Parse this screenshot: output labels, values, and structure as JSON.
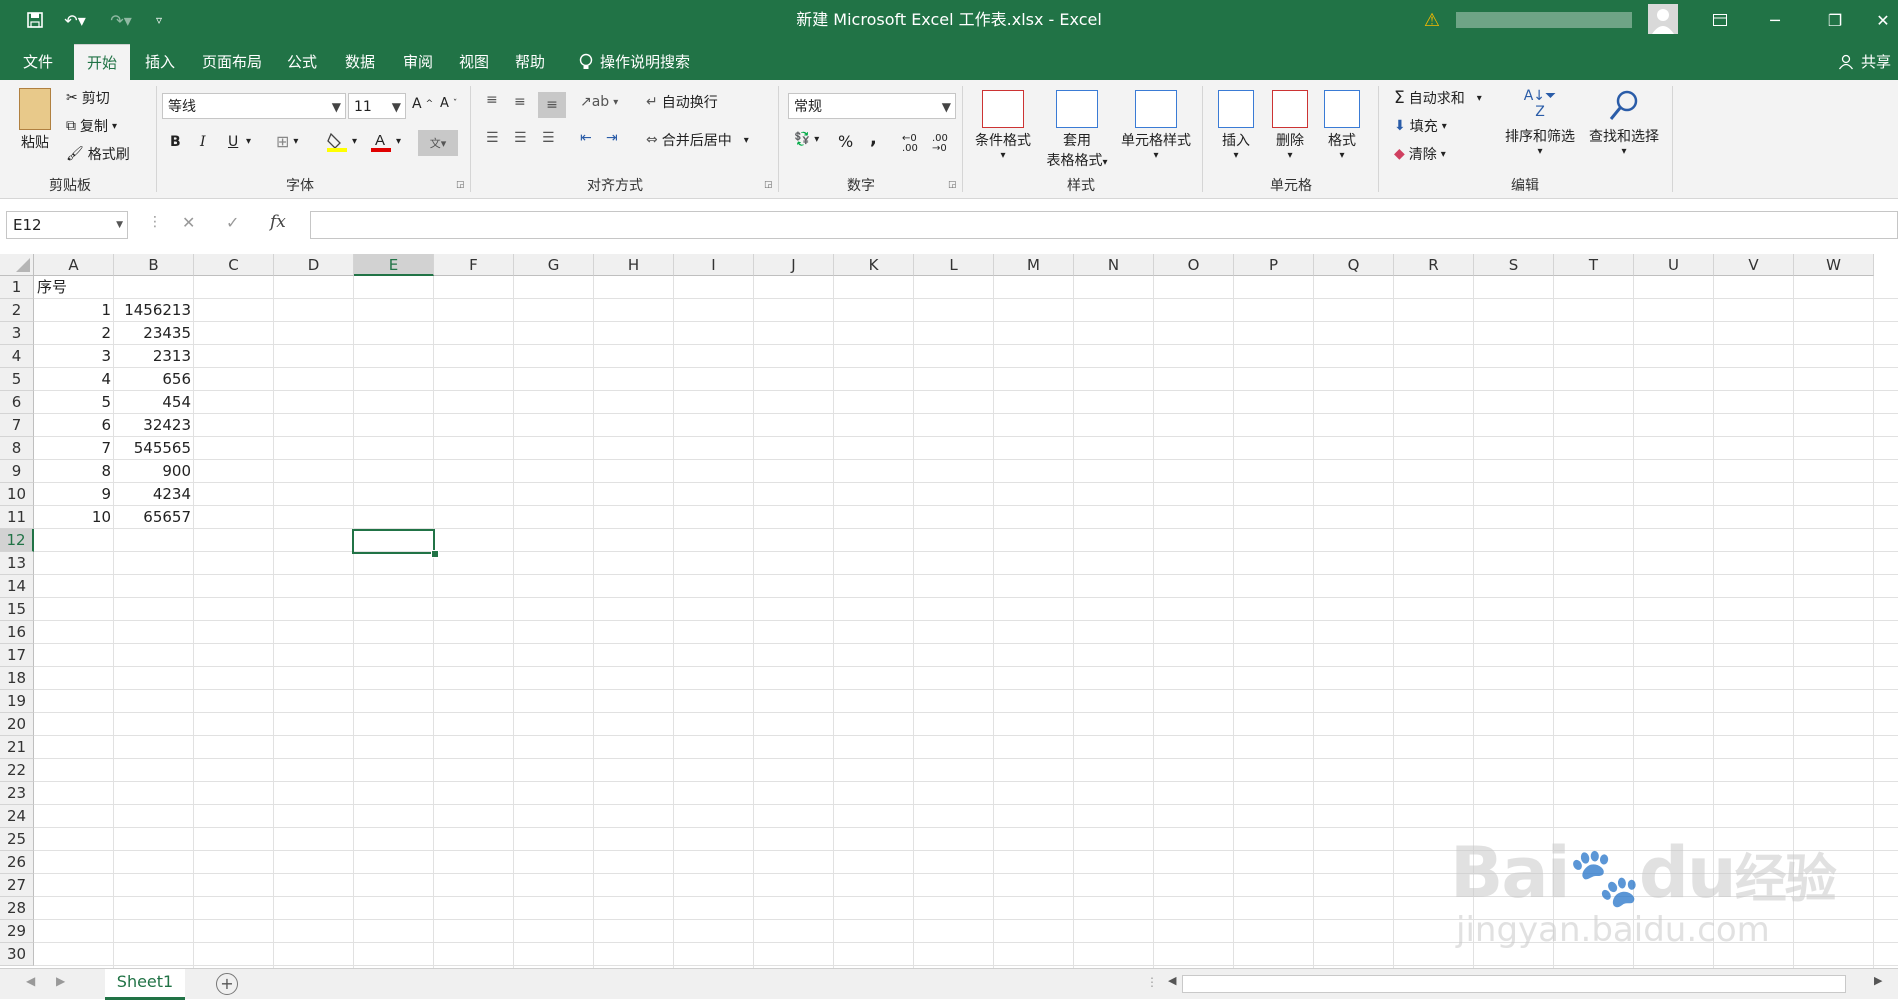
{
  "window": {
    "title": "新建 Microsoft Excel 工作表.xlsx  -  Excel"
  },
  "tabs": [
    "文件",
    "开始",
    "插入",
    "页面布局",
    "公式",
    "数据",
    "审阅",
    "视图",
    "帮助"
  ],
  "tell_me": "操作说明搜索",
  "share": "共享",
  "ribbon": {
    "clipboard": {
      "paste": "粘贴",
      "cut": "剪切",
      "copy": "复制",
      "format_painter": "格式刷",
      "label": "剪贴板"
    },
    "font": {
      "name": "等线",
      "size": "11",
      "bold": "B",
      "italic": "I",
      "underline": "U",
      "label": "字体"
    },
    "alignment": {
      "wrap": "自动换行",
      "merge": "合并后居中",
      "label": "对齐方式"
    },
    "number": {
      "format": "常规",
      "percent": "%",
      "comma": ",",
      "label": "数字"
    },
    "styles": {
      "conditional": "条件格式",
      "table_1": "套用",
      "table_2": "表格格式",
      "cell_styles": "单元格样式",
      "label": "样式"
    },
    "cells": {
      "insert": "插入",
      "delete": "删除",
      "format": "格式",
      "label": "单元格"
    },
    "editing": {
      "autosum": "自动求和",
      "fill": "填充",
      "clear": "清除",
      "sort": "排序和筛选",
      "find": "查找和选择",
      "label": "编辑"
    }
  },
  "formula_bar": {
    "name_box": "E12",
    "fx": "fx",
    "value": ""
  },
  "sheet": {
    "columns": [
      "A",
      "B",
      "C",
      "D",
      "E",
      "F",
      "G",
      "H",
      "I",
      "J",
      "K",
      "L",
      "M",
      "N",
      "O",
      "P",
      "Q",
      "R",
      "S",
      "T",
      "U",
      "V",
      "W"
    ],
    "rows": [
      "1",
      "2",
      "3",
      "4",
      "5",
      "6",
      "7",
      "8",
      "9",
      "10",
      "11",
      "12",
      "13",
      "14",
      "15",
      "16",
      "17",
      "18",
      "19",
      "20",
      "21",
      "22",
      "23",
      "24",
      "25",
      "26",
      "27",
      "28",
      "29",
      "30"
    ],
    "selected_cell": "E12",
    "header_a1": "序号",
    "col_a": [
      "1",
      "2",
      "3",
      "4",
      "5",
      "6",
      "7",
      "8",
      "9",
      "10"
    ],
    "col_b": [
      "1456213",
      "23435",
      "2313",
      "656",
      "454",
      "32423",
      "545565",
      "900",
      "4234",
      "65657"
    ]
  },
  "sheet_tabs": {
    "active": "Sheet1"
  },
  "watermark": {
    "brand": "Bai",
    "brand2": "du",
    "brand_cn": "经验",
    "url": "jingyan.baidu.com"
  },
  "colors": {
    "accent": "#217346"
  }
}
